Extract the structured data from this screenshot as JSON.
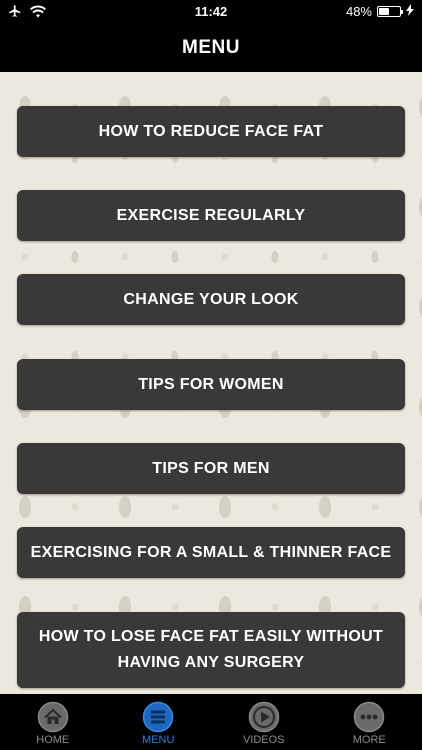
{
  "status_bar": {
    "time": "11:42",
    "battery_text": "48%",
    "battery_level": 0.48,
    "icons": [
      "airplane-icon",
      "wifi-icon",
      "battery-icon",
      "charging-bolt-icon"
    ]
  },
  "header": {
    "title": "MENU"
  },
  "menu": {
    "items": [
      {
        "label": "HOW TO REDUCE FACE FAT"
      },
      {
        "label": "EXERCISE REGULARLY"
      },
      {
        "label": "CHANGE YOUR LOOK"
      },
      {
        "label": "TIPS FOR WOMEN"
      },
      {
        "label": "TIPS FOR MEN"
      },
      {
        "label": "EXERCISING FOR A SMALL & THINNER FACE"
      },
      {
        "label": "HOW TO LOSE FACE FAT EASILY WITHOUT HAVING ANY SURGERY"
      }
    ]
  },
  "tab_bar": {
    "tabs": [
      {
        "label": "HOME",
        "icon": "home-icon"
      },
      {
        "label": "MENU",
        "icon": "menu-icon",
        "active": true
      },
      {
        "label": "VIDEOS",
        "icon": "play-icon"
      },
      {
        "label": "MORE",
        "icon": "more-icon"
      }
    ]
  },
  "colors": {
    "accent": "#2f7fd8",
    "button": "#3a3938",
    "background": "#ece8df",
    "bar": "#000000"
  }
}
